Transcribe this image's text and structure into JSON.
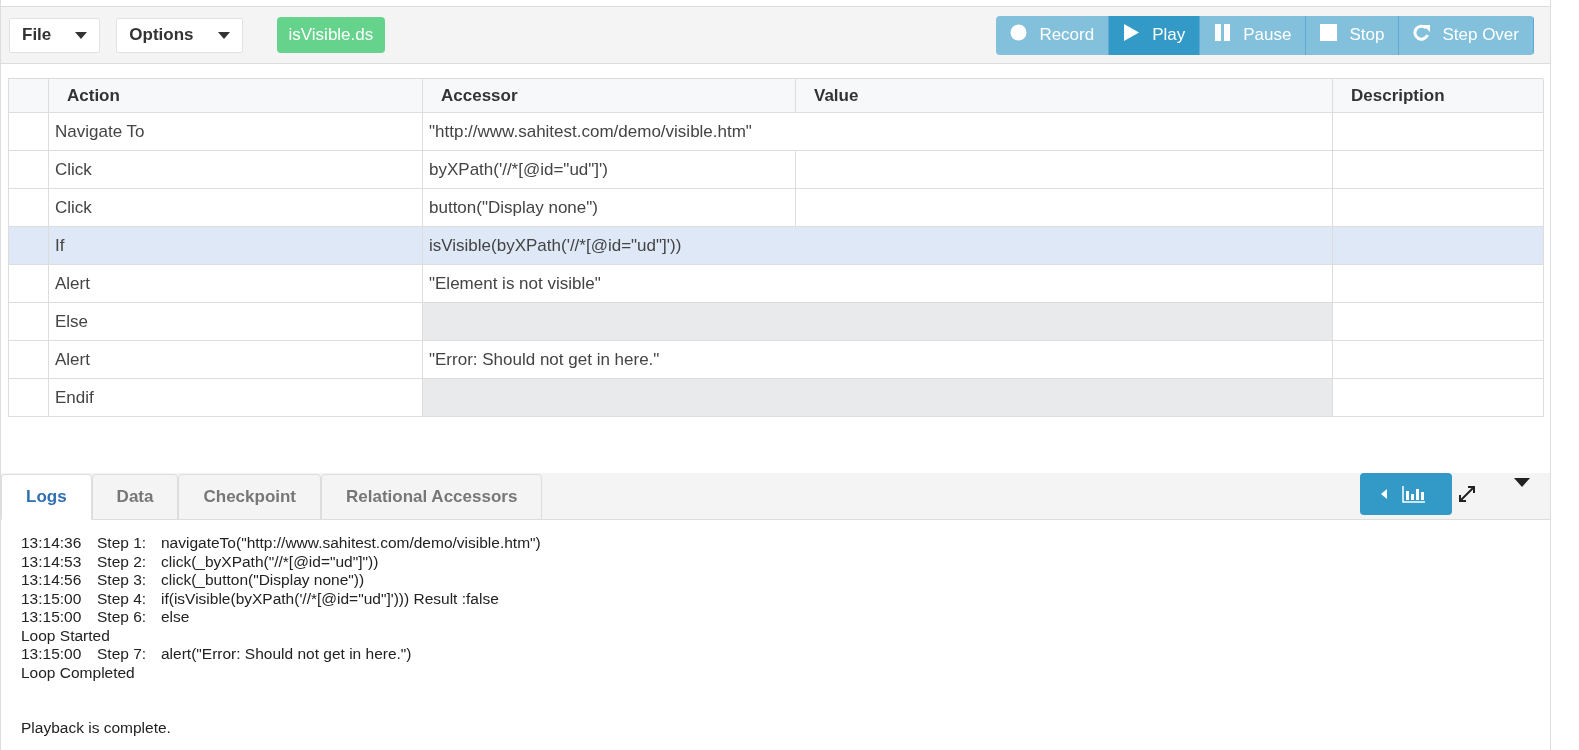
{
  "toolbar": {
    "menus": [
      {
        "label": "File"
      },
      {
        "label": "Options"
      }
    ],
    "file_badge": "isVisible.ds",
    "player_buttons": [
      {
        "label": "Record",
        "kind": "record",
        "selected": false
      },
      {
        "label": "Play",
        "kind": "play",
        "selected": true
      },
      {
        "label": "Pause",
        "kind": "pause",
        "selected": false
      },
      {
        "label": "Stop",
        "kind": "stop",
        "selected": false
      },
      {
        "label": "Step Over",
        "kind": "stepover",
        "selected": false
      }
    ]
  },
  "table": {
    "columns": [
      "Action",
      "Accessor",
      "Value",
      "Description"
    ],
    "rows": [
      {
        "kind": "span",
        "action": "Navigate To",
        "accessor": "\"http://www.sahitest.com/demo/visible.htm\"",
        "selected": false
      },
      {
        "kind": "split",
        "action": "Click",
        "accessor": "byXPath('//*[@id=\"ud\"]')",
        "selected": false
      },
      {
        "kind": "split",
        "action": "Click",
        "accessor": "button(\"Display none\")",
        "selected": false
      },
      {
        "kind": "span",
        "action": "If",
        "accessor": "isVisible(byXPath('//*[@id=\"ud\"]'))",
        "selected": true
      },
      {
        "kind": "span",
        "action": "Alert",
        "accessor": "\"Element is not visible\"",
        "selected": false
      },
      {
        "kind": "blocked",
        "action": "Else",
        "selected": false
      },
      {
        "kind": "span",
        "action": "Alert",
        "accessor": "\"Error: Should not get in here.\"",
        "selected": false
      },
      {
        "kind": "blocked",
        "action": "Endif",
        "selected": false
      }
    ]
  },
  "bottom_tabs": [
    {
      "label": "Logs",
      "selected": true
    },
    {
      "label": "Data",
      "selected": false
    },
    {
      "label": "Checkpoint",
      "selected": false
    },
    {
      "label": "Relational Accessors",
      "selected": false
    }
  ],
  "logs": [
    {
      "kind": "step",
      "time": "13:14:36",
      "step": "Step 1:",
      "text": "navigateTo(\"http://www.sahitest.com/demo/visible.htm\")"
    },
    {
      "kind": "step",
      "time": "13:14:53",
      "step": "Step 2:",
      "text": "click(_byXPath(\"//*[@id=\"ud\"]\"))"
    },
    {
      "kind": "step",
      "time": "13:14:56",
      "step": "Step 3:",
      "text": "click(_button(\"Display none\"))"
    },
    {
      "kind": "step",
      "time": "13:15:00",
      "step": "Step 4:",
      "text": "if(isVisible(byXPath('//*[@id=\"ud\"]'))) Result :false"
    },
    {
      "kind": "step",
      "time": "13:15:00",
      "step": "Step 6:",
      "text": "else"
    },
    {
      "kind": "message",
      "text": "Loop Started"
    },
    {
      "kind": "step",
      "time": "13:15:00",
      "step": "Step 7:",
      "text": "alert(\"Error: Should not get in here.\")"
    },
    {
      "kind": "message",
      "text": "Loop Completed"
    },
    {
      "kind": "status",
      "text": "Playback is complete."
    }
  ]
}
